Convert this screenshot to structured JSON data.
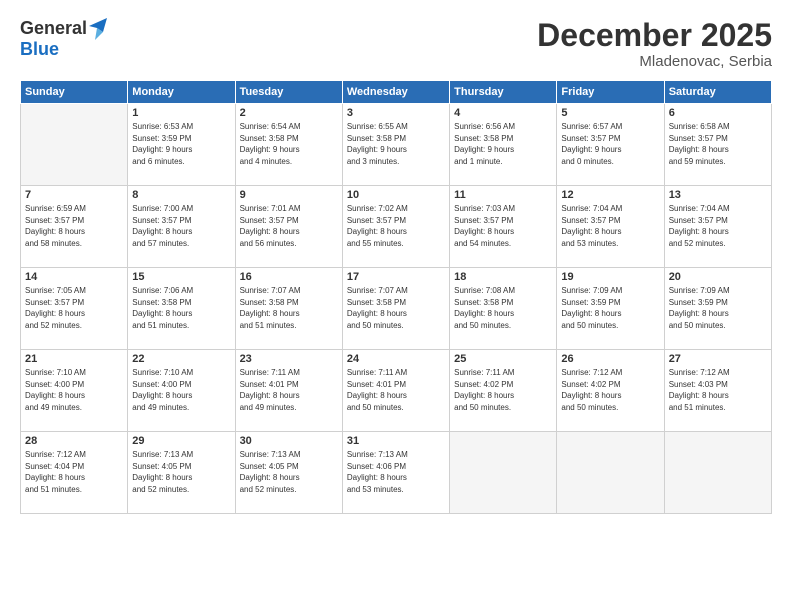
{
  "logo": {
    "general": "General",
    "blue": "Blue"
  },
  "title": "December 2025",
  "location": "Mladenovac, Serbia",
  "days_of_week": [
    "Sunday",
    "Monday",
    "Tuesday",
    "Wednesday",
    "Thursday",
    "Friday",
    "Saturday"
  ],
  "weeks": [
    [
      {
        "day": "",
        "info": "",
        "empty": true
      },
      {
        "day": "1",
        "info": "Sunrise: 6:53 AM\nSunset: 3:59 PM\nDaylight: 9 hours\nand 6 minutes."
      },
      {
        "day": "2",
        "info": "Sunrise: 6:54 AM\nSunset: 3:58 PM\nDaylight: 9 hours\nand 4 minutes."
      },
      {
        "day": "3",
        "info": "Sunrise: 6:55 AM\nSunset: 3:58 PM\nDaylight: 9 hours\nand 3 minutes."
      },
      {
        "day": "4",
        "info": "Sunrise: 6:56 AM\nSunset: 3:58 PM\nDaylight: 9 hours\nand 1 minute."
      },
      {
        "day": "5",
        "info": "Sunrise: 6:57 AM\nSunset: 3:57 PM\nDaylight: 9 hours\nand 0 minutes."
      },
      {
        "day": "6",
        "info": "Sunrise: 6:58 AM\nSunset: 3:57 PM\nDaylight: 8 hours\nand 59 minutes."
      }
    ],
    [
      {
        "day": "7",
        "info": "Sunrise: 6:59 AM\nSunset: 3:57 PM\nDaylight: 8 hours\nand 58 minutes."
      },
      {
        "day": "8",
        "info": "Sunrise: 7:00 AM\nSunset: 3:57 PM\nDaylight: 8 hours\nand 57 minutes."
      },
      {
        "day": "9",
        "info": "Sunrise: 7:01 AM\nSunset: 3:57 PM\nDaylight: 8 hours\nand 56 minutes."
      },
      {
        "day": "10",
        "info": "Sunrise: 7:02 AM\nSunset: 3:57 PM\nDaylight: 8 hours\nand 55 minutes."
      },
      {
        "day": "11",
        "info": "Sunrise: 7:03 AM\nSunset: 3:57 PM\nDaylight: 8 hours\nand 54 minutes."
      },
      {
        "day": "12",
        "info": "Sunrise: 7:04 AM\nSunset: 3:57 PM\nDaylight: 8 hours\nand 53 minutes."
      },
      {
        "day": "13",
        "info": "Sunrise: 7:04 AM\nSunset: 3:57 PM\nDaylight: 8 hours\nand 52 minutes."
      }
    ],
    [
      {
        "day": "14",
        "info": "Sunrise: 7:05 AM\nSunset: 3:57 PM\nDaylight: 8 hours\nand 52 minutes."
      },
      {
        "day": "15",
        "info": "Sunrise: 7:06 AM\nSunset: 3:58 PM\nDaylight: 8 hours\nand 51 minutes."
      },
      {
        "day": "16",
        "info": "Sunrise: 7:07 AM\nSunset: 3:58 PM\nDaylight: 8 hours\nand 51 minutes."
      },
      {
        "day": "17",
        "info": "Sunrise: 7:07 AM\nSunset: 3:58 PM\nDaylight: 8 hours\nand 50 minutes."
      },
      {
        "day": "18",
        "info": "Sunrise: 7:08 AM\nSunset: 3:58 PM\nDaylight: 8 hours\nand 50 minutes."
      },
      {
        "day": "19",
        "info": "Sunrise: 7:09 AM\nSunset: 3:59 PM\nDaylight: 8 hours\nand 50 minutes."
      },
      {
        "day": "20",
        "info": "Sunrise: 7:09 AM\nSunset: 3:59 PM\nDaylight: 8 hours\nand 50 minutes."
      }
    ],
    [
      {
        "day": "21",
        "info": "Sunrise: 7:10 AM\nSunset: 4:00 PM\nDaylight: 8 hours\nand 49 minutes."
      },
      {
        "day": "22",
        "info": "Sunrise: 7:10 AM\nSunset: 4:00 PM\nDaylight: 8 hours\nand 49 minutes."
      },
      {
        "day": "23",
        "info": "Sunrise: 7:11 AM\nSunset: 4:01 PM\nDaylight: 8 hours\nand 49 minutes."
      },
      {
        "day": "24",
        "info": "Sunrise: 7:11 AM\nSunset: 4:01 PM\nDaylight: 8 hours\nand 50 minutes."
      },
      {
        "day": "25",
        "info": "Sunrise: 7:11 AM\nSunset: 4:02 PM\nDaylight: 8 hours\nand 50 minutes."
      },
      {
        "day": "26",
        "info": "Sunrise: 7:12 AM\nSunset: 4:02 PM\nDaylight: 8 hours\nand 50 minutes."
      },
      {
        "day": "27",
        "info": "Sunrise: 7:12 AM\nSunset: 4:03 PM\nDaylight: 8 hours\nand 51 minutes."
      }
    ],
    [
      {
        "day": "28",
        "info": "Sunrise: 7:12 AM\nSunset: 4:04 PM\nDaylight: 8 hours\nand 51 minutes."
      },
      {
        "day": "29",
        "info": "Sunrise: 7:13 AM\nSunset: 4:05 PM\nDaylight: 8 hours\nand 52 minutes."
      },
      {
        "day": "30",
        "info": "Sunrise: 7:13 AM\nSunset: 4:05 PM\nDaylight: 8 hours\nand 52 minutes."
      },
      {
        "day": "31",
        "info": "Sunrise: 7:13 AM\nSunset: 4:06 PM\nDaylight: 8 hours\nand 53 minutes."
      },
      {
        "day": "",
        "info": "",
        "empty": true
      },
      {
        "day": "",
        "info": "",
        "empty": true
      },
      {
        "day": "",
        "info": "",
        "empty": true
      }
    ]
  ]
}
